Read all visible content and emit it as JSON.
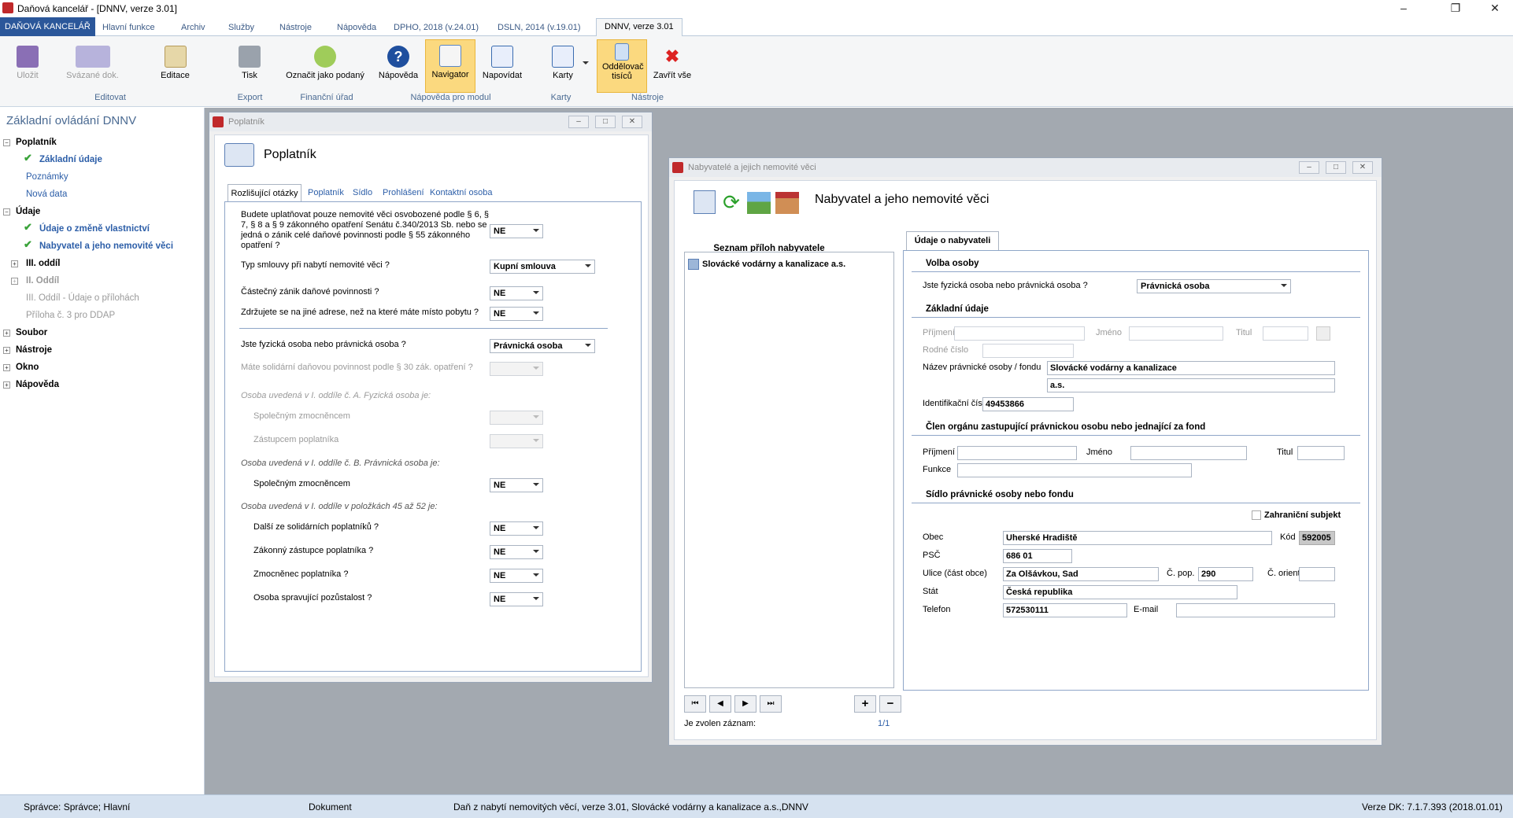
{
  "app": {
    "title": "Daňová kancelář - [DNNV, verze 3.01]"
  },
  "tabs": [
    "DAŇOVÁ KANCELÁŘ",
    "Hlavní funkce",
    "Archiv",
    "Služby",
    "Nástroje",
    "Nápověda",
    "DPHO, 2018 (v.24.01)",
    "DSLN, 2014 (v.19.01)",
    "DNNV, verze 3.01"
  ],
  "ribbon": {
    "buttons": [
      "Uložit",
      "Svázané dok.",
      "Editace",
      "Tisk",
      "Označit jako podaný",
      "Nápověda",
      "Navigator",
      "Napovídat",
      "Karty",
      "Oddělovač tisíců",
      "Zavřít vše"
    ],
    "groups": [
      "Editovat",
      "Export",
      "Finanční úřad",
      "Nápověda pro modul",
      "Karty",
      "Nástroje"
    ]
  },
  "nav": {
    "header": "Základní ovládání DNNV",
    "items": [
      "Poplatník",
      "Základní údaje",
      "Poznámky",
      "Nová data",
      "Údaje",
      "Údaje o změně vlastnictví",
      "Nabyvatel a jeho nemovité věci",
      "III. oddíl",
      "II. Oddíl",
      "III. Oddíl - Údaje o přílohách",
      "Příloha č. 3 pro DDAP",
      "Soubor",
      "Nástroje",
      "Okno",
      "Nápověda"
    ]
  },
  "win1": {
    "title": "Poplatník",
    "heading": "Poplatník",
    "tabs": [
      "Rozlišující otázky",
      "Poplatník",
      "Sídlo",
      "Prohlášení",
      "Kontaktní osoba"
    ],
    "q1": "Budete uplatňovat pouze nemovité věci osvobozené podle § 6, § 7, § 8 a § 9 zákonného opatření Senátu č.340/2013 Sb. nebo se jedná o zánik celé daňové povinnosti podle § 55 zákonného opatření ?",
    "q2": "Typ smlouvy při nabytí nemovité věci ?",
    "q3": "Částečný zánik daňové povinnosti ?",
    "q4": "Zdržujete se na jiné adrese, než na které máte místo pobytu ?",
    "q5": "Jste fyzická osoba nebo právnická osoba ?",
    "q6": "Máte solidární daňovou povinnost podle § 30 zák. opatření ?",
    "s1": "Osoba uvedená v I. oddíle č. A. Fyzická osoba je:",
    "s1a": "Společným zmocněncem",
    "s1b": "Zástupcem poplatníka",
    "s2": "Osoba uvedená v I. oddíle č. B. Právnická osoba je:",
    "s2a": "Společným zmocněncem",
    "s3": "Osoba uvedená v I. oddíle v položkách 45 až 52 je:",
    "s3a": "Další ze solidárních poplatníků ?",
    "s3b": "Zákonný zástupce poplatníka ?",
    "s3c": "Zmocněnec poplatníka ?",
    "s3d": "Osoba spravující pozůstalost ?",
    "v_ne": "NE",
    "v_smlouva": "Kupní smlouva",
    "v_pravnicka": "Právnická osoba"
  },
  "win2": {
    "title": "Nabyvatelé a jejich nemovité věci",
    "heading": "Nabyvatel a jeho nemovité věci",
    "list_header": "Seznam příloh nabyvatele",
    "list_item": "Slovácké vodárny a kanalizace a.s.",
    "selected_label": "Je zvolen záznam:",
    "selected_count": "1/1",
    "tab": "Údaje o nabyvateli",
    "sec_volba": "Volba osoby",
    "q_fyz": "Jste fyzická osoba nebo právnická osoba ?",
    "v_fyz": "Právnická osoba",
    "sec_zakladni": "Základní údaje",
    "l_prijmeni": "Příjmení",
    "l_jmeno": "Jméno",
    "l_titul": "Titul",
    "l_rodne": "Rodné číslo",
    "l_nazev": "Název právnické osoby / fondu",
    "v_nazev1": "Slovácké vodárny a kanalizace",
    "v_nazev2": "a.s.",
    "l_ico": "Identifikační číslo",
    "v_ico": "49453866",
    "sec_clen": "Člen orgánu zastupující právnickou osobu nebo jednající za fond",
    "l_funkce": "Funkce",
    "sec_sidlo": "Sídlo právnické osoby nebo fondu",
    "l_zahr": "Zahraniční subjekt",
    "l_obec": "Obec",
    "v_obec": "Uherské Hradiště",
    "l_kod": "Kód",
    "v_kod": "592005",
    "l_psc": "PSČ",
    "v_psc": "686 01",
    "l_ulice": "Ulice (část obce)",
    "v_ulice": "Za Olšávkou, Sad",
    "l_cpop": "Č. pop.",
    "v_cpop": "290",
    "l_corient": "Č. orient.",
    "l_stat": "Stát",
    "v_stat": "Česká republika",
    "l_tel": "Telefon",
    "v_tel": "572530111",
    "l_email": "E-mail"
  },
  "status": {
    "user": "Správce: Správce; Hlavní",
    "doc": "Dokument",
    "info": "Daň z nabytí nemovitých věcí, verze 3.01, Slovácké vodárny a kanalizace a.s.,DNNV",
    "version": "Verze DK: 7.1.7.393 (2018.01.01)"
  }
}
